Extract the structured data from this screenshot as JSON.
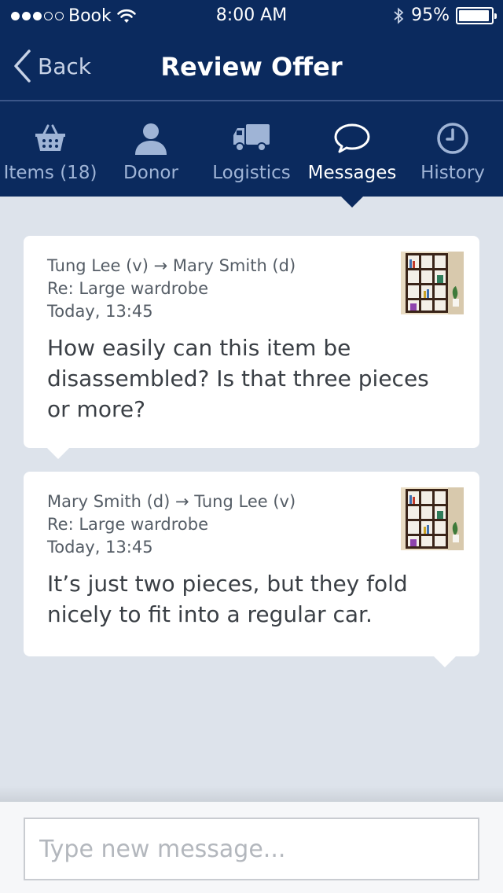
{
  "status_bar": {
    "carrier": "Book",
    "time": "8:00 AM",
    "battery": "95%",
    "battery_level": 0.95
  },
  "nav": {
    "back_label": "Back",
    "title": "Review Offer"
  },
  "tabs": [
    {
      "label": "Items (18)",
      "icon": "basket-icon",
      "active": false
    },
    {
      "label": "Donor",
      "icon": "person-icon",
      "active": false
    },
    {
      "label": "Logistics",
      "icon": "truck-icon",
      "active": false
    },
    {
      "label": "Messages",
      "icon": "speech-bubble-icon",
      "active": true
    },
    {
      "label": "History",
      "icon": "clock-icon",
      "active": false
    }
  ],
  "messages": [
    {
      "route": "Tung Lee (v) → Mary Smith (d)",
      "subject": "Re: Large wardrobe",
      "time": "Today, 13:45",
      "body": "How easily can this item be disassembled? Is that three pieces or more?",
      "thumbnail": "bookshelf-thumbnail"
    },
    {
      "route": "Mary Smith (d) → Tung Lee (v)",
      "subject": "Re: Large wardrobe",
      "time": "Today, 13:45",
      "body": "It’s just two pieces, but they fold nicely to fit into a regular car.",
      "thumbnail": "bookshelf-thumbnail"
    }
  ],
  "compose": {
    "placeholder": "Type new message...",
    "value": ""
  },
  "colors": {
    "primary": "#0b2a5e",
    "background": "#dde3eb",
    "tab_inactive": "#9fb4d6"
  }
}
